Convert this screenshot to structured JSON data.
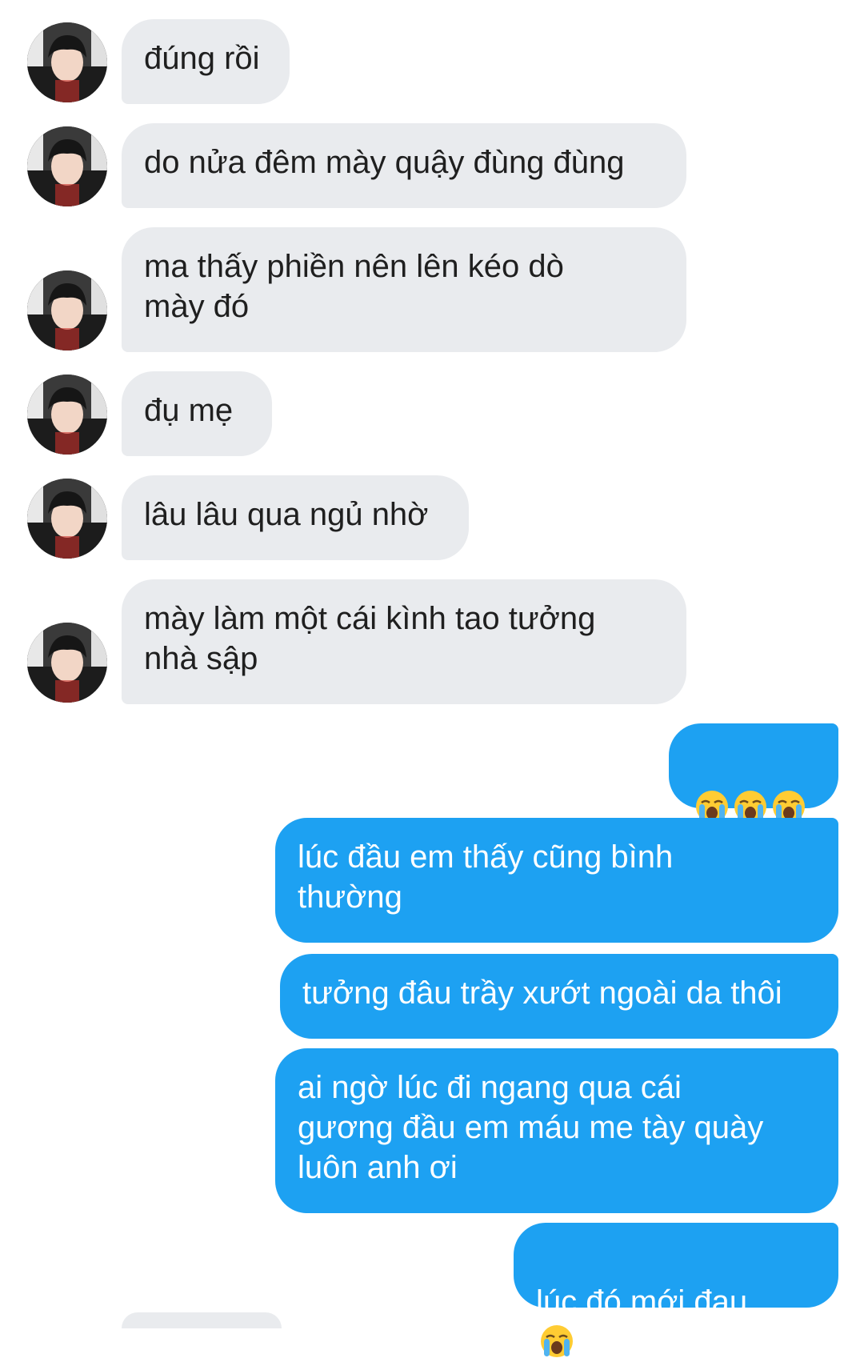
{
  "colors": {
    "incoming_bg": "#e9ebee",
    "outgoing_bg": "#1da1f2",
    "incoming_text": "#1f1f1f",
    "outgoing_text": "#ffffff"
  },
  "incoming": [
    {
      "text": "đúng rồi"
    },
    {
      "text": "do nửa đêm mày quậy đùng đùng"
    },
    {
      "text": "ma thấy phiền nên lên kéo dò\nmày đó"
    },
    {
      "text": "đụ mẹ"
    },
    {
      "text": "lâu lâu qua ngủ nhờ"
    },
    {
      "text": "mày làm một cái kình tao tưởng\nnhà sập"
    }
  ],
  "outgoing": [
    {
      "text": "",
      "emoji": [
        "loudly-crying-face",
        "loudly-crying-face",
        "loudly-crying-face"
      ]
    },
    {
      "text": "lúc đầu em thấy cũng bình\nthường"
    },
    {
      "text": "tưởng đâu trầy xướt ngoài da thôi"
    },
    {
      "text": "ai ngờ lúc đi ngang qua cái\ngương đầu em máu me tày quày\nluôn anh ơi"
    },
    {
      "text": "lúc đó mới đau",
      "emoji": [
        "loudly-crying-face"
      ]
    }
  ]
}
